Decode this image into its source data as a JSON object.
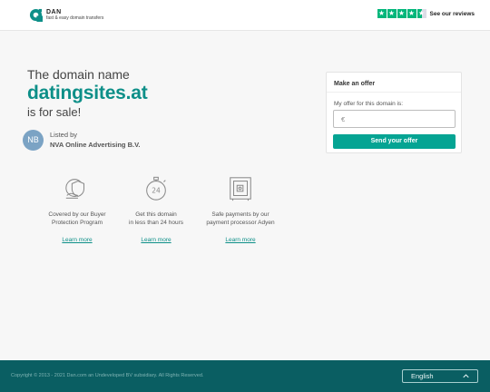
{
  "header": {
    "logo_name": "DAN",
    "logo_tagline": "fast & easy domain transfers",
    "reviews_link": "See our reviews",
    "rating_stars": 4.5
  },
  "intro": {
    "line1": "The domain name",
    "domain": "datingsites.at",
    "line3": "is for sale!"
  },
  "seller": {
    "initials": "NB",
    "label": "Listed by",
    "name": "NVA Online Advertising B.V."
  },
  "offer": {
    "title": "Make an offer",
    "label": "My offer for this domain is:",
    "currency": "€",
    "button": "Send your offer"
  },
  "features": [
    {
      "icon": "shield-hand-icon",
      "line1": "Covered by our Buyer",
      "line2": "Protection Program",
      "link": "Learn more"
    },
    {
      "icon": "stopwatch-24-icon",
      "line1": "Get this domain",
      "line2": "in less than 24 hours",
      "link": "Learn more"
    },
    {
      "icon": "safe-icon",
      "line1": "Safe payments by our",
      "line2": "payment processor Adyen",
      "link": "Learn more"
    }
  ],
  "footer": {
    "copyright": "Copyright © 2013 - 2021 Dan.com an Undeveloped BV subsidiary. All Rights Reserved.",
    "language": "English"
  },
  "colors": {
    "brand_teal": "#0d8f88",
    "button_green": "#05a493",
    "footer_bg": "#0a5e62",
    "trustpilot_green": "#00b67a"
  }
}
